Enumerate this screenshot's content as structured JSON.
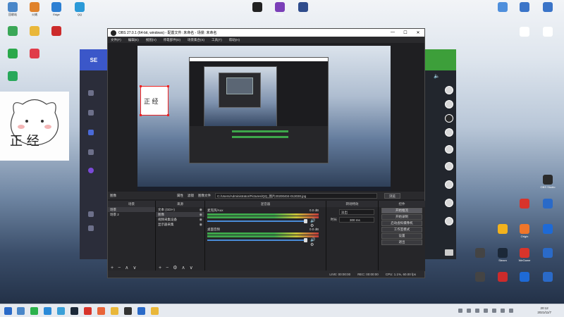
{
  "desktop": {
    "left_icons": [
      {
        "label": "回收站",
        "color": "#4a87c9"
      },
      {
        "label": "火绒",
        "color": "#e0822b"
      },
      {
        "label": "Edge",
        "color": "#2c7fd3"
      },
      {
        "label": "QQ",
        "color": "#2b9ad8"
      },
      {
        "label": "",
        "color": "#3aa757"
      },
      {
        "label": "",
        "color": "#e9b73a"
      },
      {
        "label": "",
        "color": "#cc2b2b"
      },
      {
        "label": "",
        "color": "#2aa84a"
      },
      {
        "label": "",
        "color": "#e03c4a"
      },
      {
        "label": "",
        "color": "#28a85a"
      }
    ],
    "top_icons": [
      {
        "label": "",
        "color": "#222222"
      },
      {
        "label": "Premie..",
        "color": "#7b3fb8"
      },
      {
        "label": "",
        "color": "#2f4c8c"
      }
    ],
    "right_top_icons": [
      {
        "label": "",
        "color": "#4f8fdc"
      },
      {
        "label": "",
        "color": "#3a74c8"
      },
      {
        "label": "",
        "color": "#3a74c8"
      },
      {
        "label": "",
        "color": "#ffffff"
      },
      {
        "label": "",
        "color": "#ffffff"
      }
    ],
    "right_icons": [
      {
        "label": "OBS Studio",
        "color": "#2b2b2b"
      },
      {
        "label": "",
        "color": "#d8342b"
      },
      {
        "label": "",
        "color": "#2a6ac8"
      },
      {
        "label": "",
        "color": "#f3b21c"
      },
      {
        "label": "Origin",
        "color": "#f0762a"
      },
      {
        "label": "",
        "color": "#1e6ad6"
      },
      {
        "label": "",
        "color": "#444444"
      },
      {
        "label": "Steam",
        "color": "#1b2838"
      },
      {
        "label": "WeGame",
        "color": "#d8342b"
      },
      {
        "label": "",
        "color": "#2a6ac8"
      },
      {
        "label": "",
        "color": "#444444"
      },
      {
        "label": "",
        "color": "#cc2b2b"
      },
      {
        "label": "",
        "color": "#1e6ad6"
      },
      {
        "label": "",
        "color": "#2a6ac8"
      },
      {
        "label": "",
        "color": "#2a6ac8"
      }
    ],
    "sticker_text": "正 经"
  },
  "left_app": {
    "logo": "SE"
  },
  "obs": {
    "title": "OBS 27.0.1 (64-bit, windows) - 配置文件: 未命名 - 场景: 未命名",
    "window_controls": [
      "—",
      "☐",
      "✕"
    ],
    "menu": [
      "文件(F)",
      "编辑(E)",
      "视图(V)",
      "停靠部件(D)",
      "场景集合(S)",
      "工具(T)",
      "帮助(H)"
    ],
    "source_bar": {
      "scene": "图像",
      "properties": "属性",
      "filters": "滤镜",
      "image_file_label": "图像文件",
      "path": "C:/Users/Administrator/Pictures/QQ_图片20200404-013030.jpg",
      "browse": "浏览"
    },
    "docks": {
      "scenes": {
        "header": "场景",
        "items": [
          "场景",
          "场景 2"
        ]
      },
      "sources": {
        "header": "来源",
        "items": [
          "文本 (GDI+)",
          "图像",
          "视频采集设备",
          "显示器采集"
        ]
      },
      "mixer": {
        "header": "混音器",
        "channels": [
          {
            "name": "麦克风/Aux",
            "db": "0.0 dB"
          },
          {
            "name": "桌面音频",
            "db": "0.0 dB"
          }
        ]
      },
      "transitions": {
        "header": "转场特效",
        "type": "淡出",
        "duration_label": "时长",
        "duration": "300 ms"
      },
      "controls": {
        "header": "控件",
        "buttons": [
          "开始推流",
          "开始录制",
          "启动虚拟摄像机",
          "工作室模式",
          "设置",
          "退出"
        ]
      }
    },
    "status": {
      "live": "LIVE: 00:00:00",
      "rec": "REC: 00:00:00",
      "cpu": "CPU: 1.1%, 60.00 fps"
    }
  },
  "taskbar": {
    "icons": [
      {
        "color": "#4a87c9"
      },
      {
        "color": "#2bb24c"
      },
      {
        "color": "#2a8ad8"
      },
      {
        "color": "#3aa0d8"
      },
      {
        "color": "#1b2838"
      },
      {
        "color": "#d8342b"
      },
      {
        "color": "#e9653a"
      },
      {
        "color": "#e9b73a"
      },
      {
        "color": "#333333"
      },
      {
        "color": "#2a6ac8"
      },
      {
        "color": "#e9b73a"
      }
    ],
    "time": "20:12",
    "date": "2021/11/7"
  },
  "colors": {
    "obs_bg": "#1f1f22",
    "accent_red": "#e22222",
    "meter_green": "#3ea64b"
  }
}
